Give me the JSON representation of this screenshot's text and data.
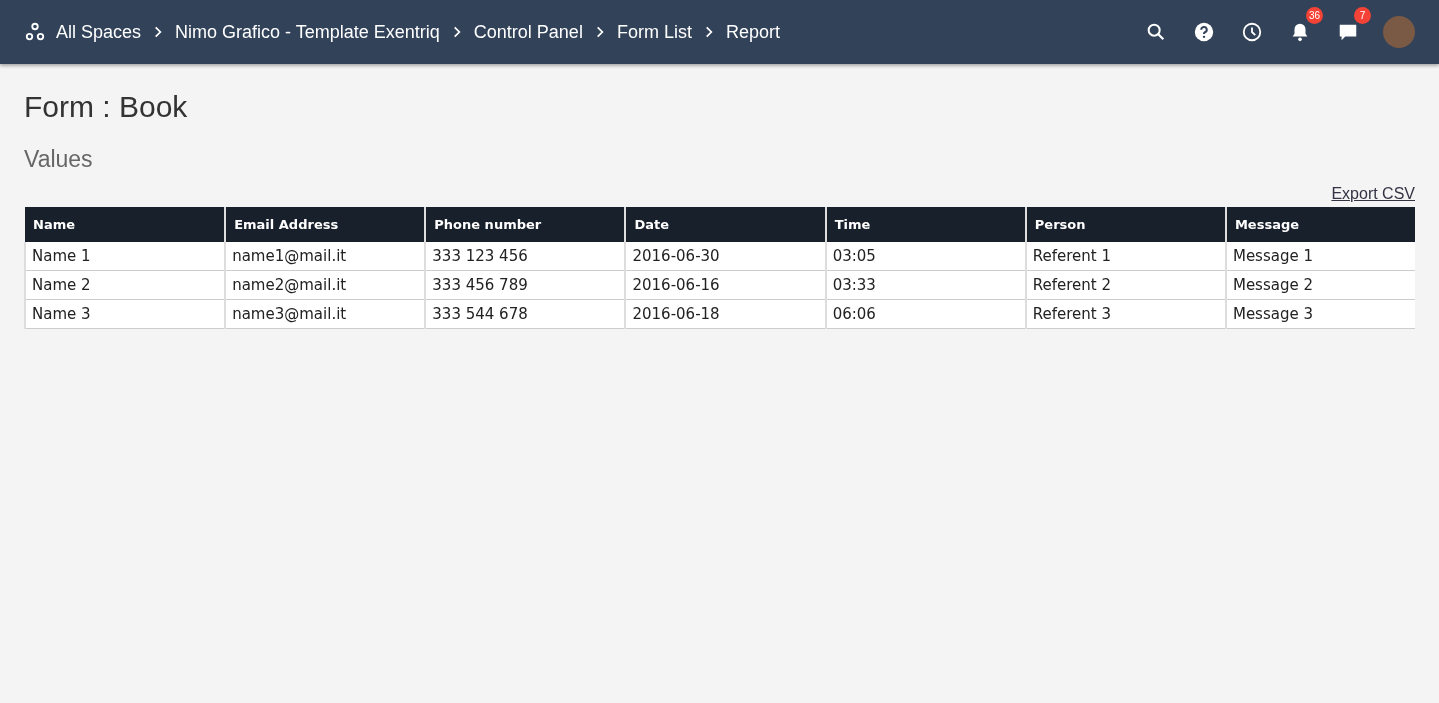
{
  "breadcrumbs": [
    "All Spaces",
    "Nimo Grafico - Template Exentriq",
    "Control Panel",
    "Form List",
    "Report"
  ],
  "header_icons": [
    {
      "kind": "search"
    },
    {
      "kind": "help"
    },
    {
      "kind": "clock"
    },
    {
      "kind": "bell",
      "badge": "36"
    },
    {
      "kind": "chat",
      "badge": "7"
    },
    {
      "kind": "avatar"
    }
  ],
  "title": "Form : Book",
  "subtitle": "Values",
  "export_link": "Export CSV",
  "table": {
    "columns": [
      "Name",
      "Email Address",
      "Phone number",
      "Date",
      "Time",
      "Person",
      "Message"
    ],
    "rows": [
      [
        "Name 1",
        "name1@mail.it",
        "333 123 456",
        "2016-06-30",
        "03:05",
        "Referent 1",
        "Message 1"
      ],
      [
        "Name 2",
        "name2@mail.it",
        "333 456 789",
        "2016-06-16",
        "03:33",
        "Referent 2",
        "Message 2"
      ],
      [
        "Name 3",
        "name3@mail.it",
        "333 544 678",
        "2016-06-18",
        "06:06",
        "Referent 3",
        "Message 3"
      ]
    ]
  }
}
